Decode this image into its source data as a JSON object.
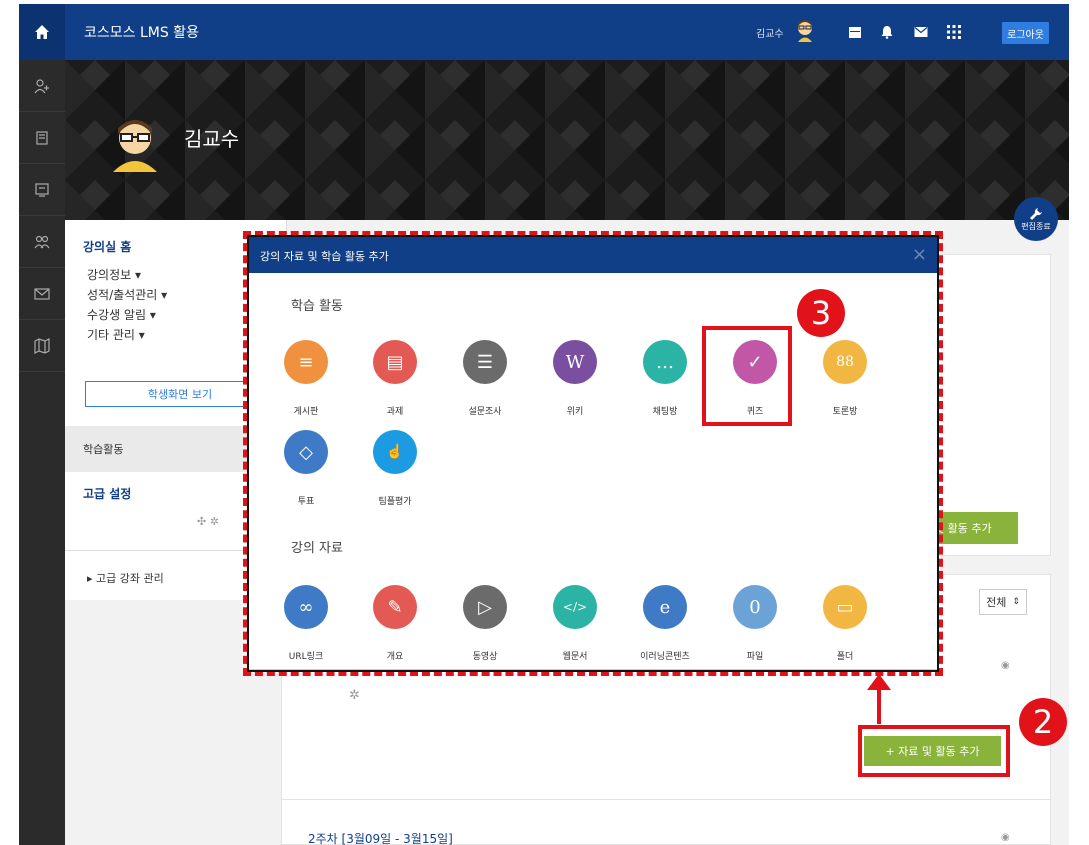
{
  "topbar": {
    "brand": "코스모스 LMS 활용",
    "user_name": "김교수",
    "logout": "로그아웃"
  },
  "hero": {
    "name": "김교수"
  },
  "left_panel": {
    "title": "강의실 홈",
    "menu": [
      "강의정보 ▾",
      "성적/출석관리 ▾",
      "수강생 알림 ▾",
      "기타 관리 ▾"
    ],
    "student_view": "학생화면 보기",
    "section_activity": "학습활동",
    "advanced_title": "고급 설정",
    "advanced_item": "▸ 고급 강좌 관리"
  },
  "edit_button": "편집종료",
  "content": {
    "add_button_partial": "료 및 활동 추가",
    "filter_select": "전체",
    "add_button": "+ 자료 및 활동 추가",
    "week2": "2주차 [3월09일 - 3월15일]"
  },
  "modal": {
    "title": "강의 자료 및 학습 활동 추가",
    "activities_title": "학습 활동",
    "activities": [
      {
        "label": "게시판",
        "color": "#f0913f",
        "glyph": "≡"
      },
      {
        "label": "과제",
        "color": "#e35a55",
        "glyph": "▤"
      },
      {
        "label": "설문조사",
        "color": "#6b6b6b",
        "glyph": "☰"
      },
      {
        "label": "위키",
        "color": "#7b4fa0",
        "glyph": "W"
      },
      {
        "label": "채팅방",
        "color": "#2bb3a5",
        "glyph": "…"
      },
      {
        "label": "퀴즈",
        "color": "#c257a8",
        "glyph": "✓"
      },
      {
        "label": "토론방",
        "color": "#f2b643",
        "glyph": "88"
      },
      {
        "label": "투표",
        "color": "#3f7ac6",
        "glyph": "◇"
      },
      {
        "label": "팀플평가",
        "color": "#1d9be2",
        "glyph": "👍"
      }
    ],
    "resources_title": "강의 자료",
    "resources": [
      {
        "label": "URL링크",
        "color": "#3f7ac6",
        "glyph": "∞"
      },
      {
        "label": "개요",
        "color": "#e35a55",
        "glyph": "✎"
      },
      {
        "label": "동영상",
        "color": "#6b6b6b",
        "glyph": "▷"
      },
      {
        "label": "웹문서",
        "color": "#2bb3a5",
        "glyph": "</>"
      },
      {
        "label": "이러닝콘텐츠",
        "color": "#3f7ac6",
        "glyph": "e"
      },
      {
        "label": "파일",
        "color": "#6ba3d6",
        "glyph": "0"
      },
      {
        "label": "폴더",
        "color": "#f2b643",
        "glyph": "▭"
      }
    ]
  },
  "annotations": {
    "badge_2": "2",
    "badge_3": "3"
  }
}
